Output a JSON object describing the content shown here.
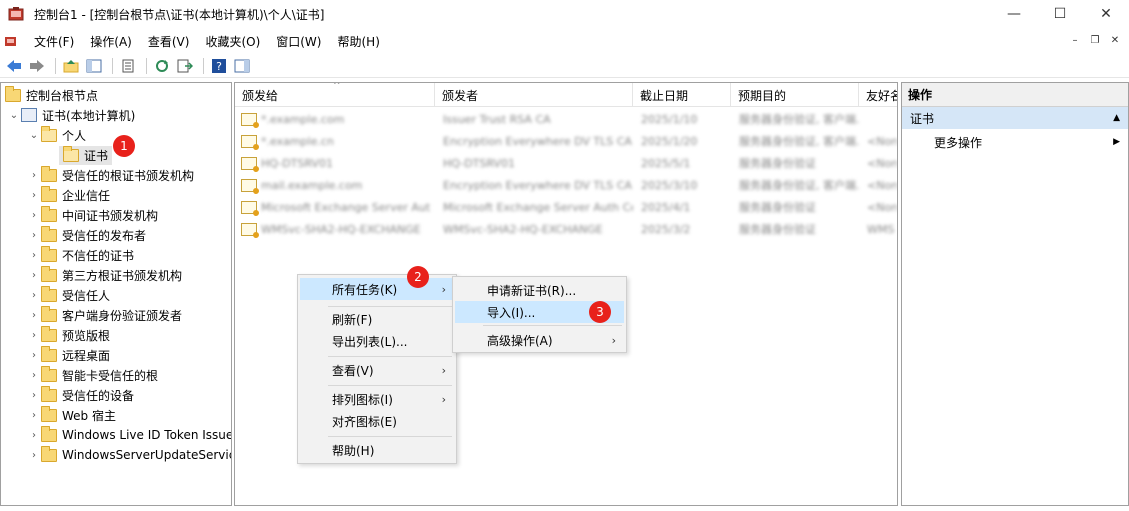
{
  "window": {
    "title": "控制台1 - [控制台根节点\\证书(本地计算机)\\个人\\证书]",
    "minimize": "—",
    "maximize": "☐",
    "close": "✕"
  },
  "menu": [
    "文件(F)",
    "操作(A)",
    "查看(V)",
    "收藏夹(O)",
    "窗口(W)",
    "帮助(H)"
  ],
  "mdi": {
    "minimize": "–",
    "restore": "❐",
    "close": "✕"
  },
  "tree": {
    "root": "控制台根节点",
    "store": "证书(本地计算机)",
    "personal": "个人",
    "selected": "证书",
    "folders": [
      "受信任的根证书颁发机构",
      "企业信任",
      "中间证书颁发机构",
      "受信任的发布者",
      "不信任的证书",
      "第三方根证书颁发机构",
      "受信任人",
      "客户端身份验证颁发者",
      "预览版根",
      "远程桌面",
      "智能卡受信任的根",
      "受信任的设备",
      "Web 宿主",
      "Windows Live ID Token Issuer",
      "WindowsServerUpdateServices"
    ]
  },
  "list": {
    "columns": [
      "颁发给",
      "颁发者",
      "截止日期",
      "预期目的",
      "友好名称"
    ],
    "rows": [
      [
        "*.example.com",
        "Issuer Trust RSA CA",
        "2025/1/10",
        "服务器身份验证, 客户端...",
        ""
      ],
      [
        "*.example.cn",
        "Encryption Everywhere DV TLS CA",
        "2025/1/20",
        "服务器身份验证, 客户端...",
        "<None>"
      ],
      [
        "HQ-DTSRV01",
        "HQ-DTSRV01",
        "2025/5/1",
        "服务器身份验证",
        "<None>"
      ],
      [
        "mail.example.com",
        "Encryption Everywhere DV TLS CA",
        "2025/3/10",
        "服务器身份验证, 客户端...",
        "<None>"
      ],
      [
        "Microsoft Exchange Server Auth Certificate",
        "Microsoft Exchange Server Auth Certificate",
        "2025/4/1",
        "服务器身份验证",
        "<None>"
      ],
      [
        "WMSvc-SHA2-HQ-EXCHANGE",
        "WMSvc-SHA2-HQ-EXCHANGE",
        "2025/3/2",
        "服务器身份验证",
        "WMS"
      ]
    ]
  },
  "actions": {
    "header": "操作",
    "section": "证书",
    "more": "更多操作"
  },
  "context_menu": {
    "all_tasks": "所有任务(K)",
    "refresh": "刷新(F)",
    "export_list": "导出列表(L)...",
    "view": "查看(V)",
    "arrange_icons": "排列图标(I)",
    "line_up_icons": "对齐图标(E)",
    "help": "帮助(H)"
  },
  "submenu": {
    "request_new": "申请新证书(R)...",
    "import": "导入(I)...",
    "advanced": "高级操作(A)"
  },
  "annotations": [
    "1",
    "2",
    "3"
  ],
  "colors": {
    "badge": "#e8211b",
    "highlight": "#cce8ff",
    "action_section": "#d5e6f7"
  }
}
